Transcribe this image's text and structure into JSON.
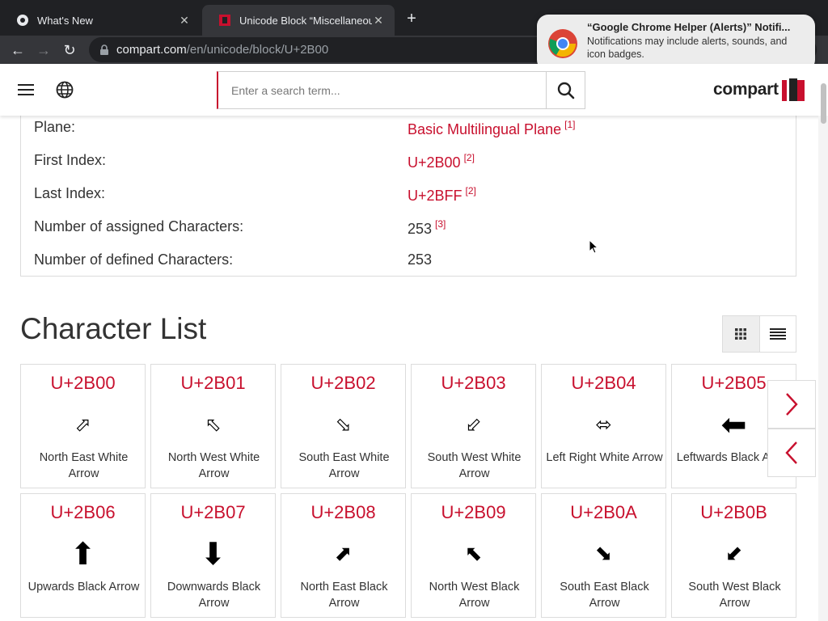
{
  "browser": {
    "tabs": [
      {
        "title": "What's New",
        "close": "✕"
      },
      {
        "title": "Unicode Block “Miscellaneous",
        "close": "✕"
      }
    ],
    "new_tab": "+",
    "nav": {
      "back": "←",
      "forward": "→",
      "reload": "↻"
    },
    "url_host": "compart.com",
    "url_path": "/en/unicode/block/U+2B00"
  },
  "notification": {
    "title": "“Google Chrome Helper (Alerts)” Notifi...",
    "body": "Notifications may include alerts, sounds, and icon badges."
  },
  "header": {
    "search_placeholder": "Enter a search term...",
    "logo_text": "compart"
  },
  "info": {
    "rows": [
      {
        "label": "Plane:",
        "value": "Basic Multilingual Plane",
        "ref": "[1]",
        "link": true
      },
      {
        "label": "First Index:",
        "value": "U+2B00",
        "ref": "[2]",
        "link": true
      },
      {
        "label": "Last Index:",
        "value": "U+2BFF",
        "ref": "[2]",
        "link": true
      },
      {
        "label": "Number of assigned Characters:",
        "value": "253",
        "ref": "[3]",
        "link": false
      },
      {
        "label": "Number of defined Characters:",
        "value": "253",
        "ref": "",
        "link": false
      }
    ]
  },
  "character_list": {
    "title": "Character List",
    "cards": [
      {
        "code": "U+2B00",
        "glyph": "⬀",
        "name": "North East White Arrow"
      },
      {
        "code": "U+2B01",
        "glyph": "⬁",
        "name": "North West White Arrow"
      },
      {
        "code": "U+2B02",
        "glyph": "⬂",
        "name": "South East White Arrow"
      },
      {
        "code": "U+2B03",
        "glyph": "⬃",
        "name": "South West White Arrow"
      },
      {
        "code": "U+2B04",
        "glyph": "⬄",
        "name": "Left Right White Arrow"
      },
      {
        "code": "U+2B05",
        "glyph": "⬅",
        "name": "Leftwards Black Arrow"
      },
      {
        "code": "U+2B06",
        "glyph": "⬆",
        "name": "Upwards Black Arrow"
      },
      {
        "code": "U+2B07",
        "glyph": "⬇",
        "name": "Downwards Black Arrow"
      },
      {
        "code": "U+2B08",
        "glyph": "⬈",
        "name": "North East Black Arrow"
      },
      {
        "code": "U+2B09",
        "glyph": "⬉",
        "name": "North West Black Arrow"
      },
      {
        "code": "U+2B0A",
        "glyph": "⬊",
        "name": "South East Black Arrow"
      },
      {
        "code": "U+2B0B",
        "glyph": "⬋",
        "name": "South West Black Arrow"
      }
    ]
  },
  "colors": {
    "accent": "#c8102e",
    "chrome_dark": "#202124",
    "chrome_toolbar": "#35363a"
  },
  "icons": {
    "menu": "hamburger-menu-icon",
    "language": "globe-icon",
    "search": "search-icon",
    "grid_view": "grid-view-icon",
    "list_view": "list-view-icon",
    "next": "chevron-right-icon",
    "previous": "chevron-left-icon"
  }
}
